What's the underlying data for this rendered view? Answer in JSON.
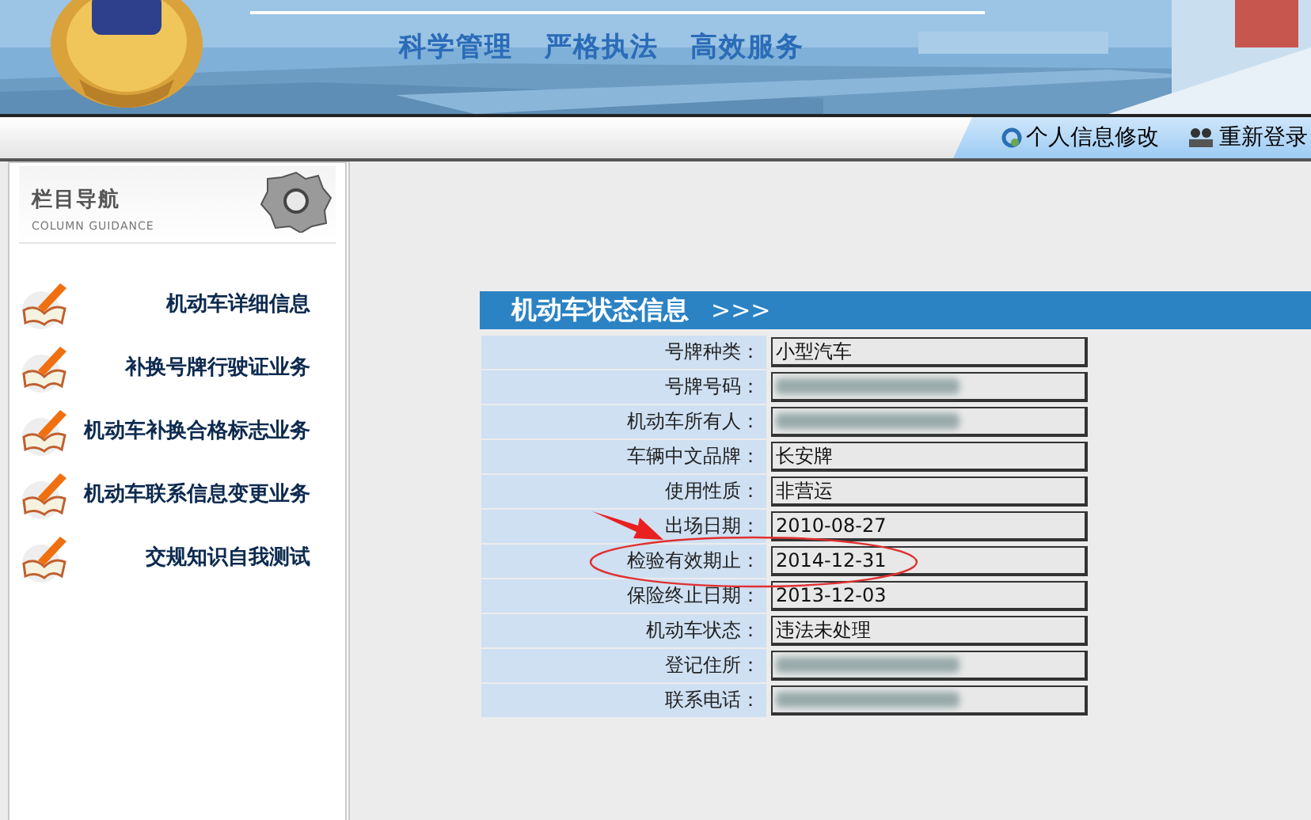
{
  "header": {
    "slogans": [
      "科学管理",
      "严格执法",
      "高效服务"
    ]
  },
  "toolbar": {
    "links": [
      {
        "label": "个人信息修改",
        "kind": "profile"
      },
      {
        "label": "重新登录",
        "kind": "relogin"
      }
    ]
  },
  "sidebar": {
    "title": "栏目导航",
    "subtitle": "COLUMN GUIDANCE",
    "items": [
      {
        "label": "机动车详细信息"
      },
      {
        "label": "补换号牌行驶证业务"
      },
      {
        "label": "机动车补换合格标志业务"
      },
      {
        "label": "机动车联系信息变更业务"
      },
      {
        "label": "交规知识自我测试"
      }
    ]
  },
  "panel": {
    "title": "机动车状态信息",
    "arrows": ">>>",
    "rows": [
      {
        "label": "号牌种类：",
        "value": "小型汽车",
        "blurred": false,
        "highlighted": false
      },
      {
        "label": "号牌号码：",
        "blurred": true,
        "highlighted": false
      },
      {
        "label": "机动车所有人：",
        "blurred": true,
        "highlighted": false
      },
      {
        "label": "车辆中文品牌：",
        "value": "长安牌",
        "blurred": false,
        "highlighted": false
      },
      {
        "label": "使用性质：",
        "value": "非营运",
        "blurred": false,
        "highlighted": false
      },
      {
        "label": "出场日期：",
        "value": "2010-08-27",
        "blurred": false,
        "highlighted": false
      },
      {
        "label": "检验有效期止：",
        "value": "2014-12-31",
        "blurred": false,
        "highlighted": true
      },
      {
        "label": "保险终止日期：",
        "value": "2013-12-03",
        "blurred": false,
        "highlighted": false
      },
      {
        "label": "机动车状态：",
        "value": "违法未处理",
        "blurred": false,
        "highlighted": false
      },
      {
        "label": "登记住所：",
        "blurred": true,
        "highlighted": false
      },
      {
        "label": "联系电话：",
        "blurred": true,
        "highlighted": false
      }
    ]
  }
}
